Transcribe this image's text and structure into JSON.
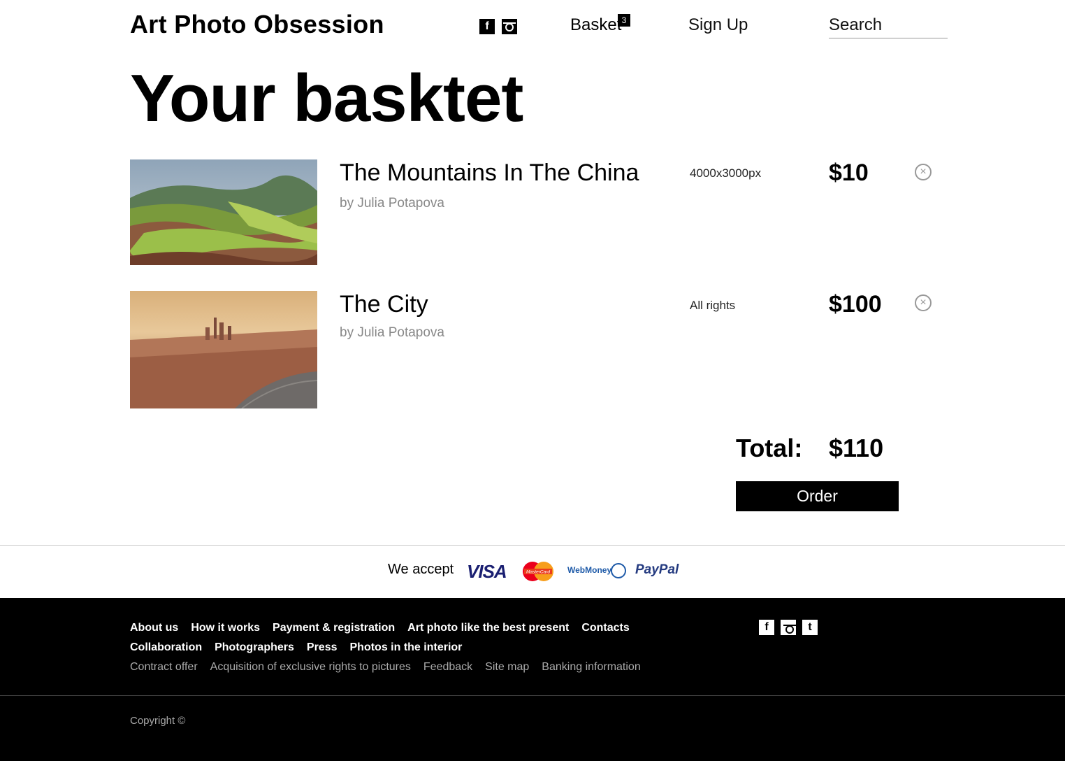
{
  "header": {
    "logo": "Art Photo Obsession",
    "facebook_glyph": "f",
    "basket_label": "Basket",
    "basket_count": "3",
    "signup_label": "Sign Up",
    "search_placeholder": "Search",
    "icons": [
      "facebook-icon",
      "instagram-icon"
    ]
  },
  "page_title": "Your basktet",
  "items": [
    {
      "title": "The Mountains In The China",
      "author": "by Julia Potapova",
      "spec": "4000x3000px",
      "price": "$10",
      "remove_glyph": "×"
    },
    {
      "title": "The City",
      "author": "by Julia Potapova",
      "spec": "All rights",
      "price": "$100",
      "remove_glyph": "×"
    }
  ],
  "total": {
    "label": "Total:",
    "value": "$110"
  },
  "order_label": "Order",
  "payment": {
    "label": "We accept",
    "visa": "VISA",
    "mastercard": "MasterCard",
    "webmoney": "WebMoney",
    "paypal": "PayPal"
  },
  "footer": {
    "row1": [
      "About us",
      "How it works",
      "Payment & registration",
      "Art photo like the best present",
      "Contacts"
    ],
    "row2": [
      "Collaboration",
      "Photographers",
      "Press",
      "Photos in the interior"
    ],
    "row3": [
      "Contract offer",
      "Acquisition of exclusive rights to pictures",
      "Feedback",
      "Site map",
      "Banking information"
    ],
    "social": {
      "facebook": "f",
      "tumblr": "t"
    },
    "copyright": "Copyright ©"
  }
}
